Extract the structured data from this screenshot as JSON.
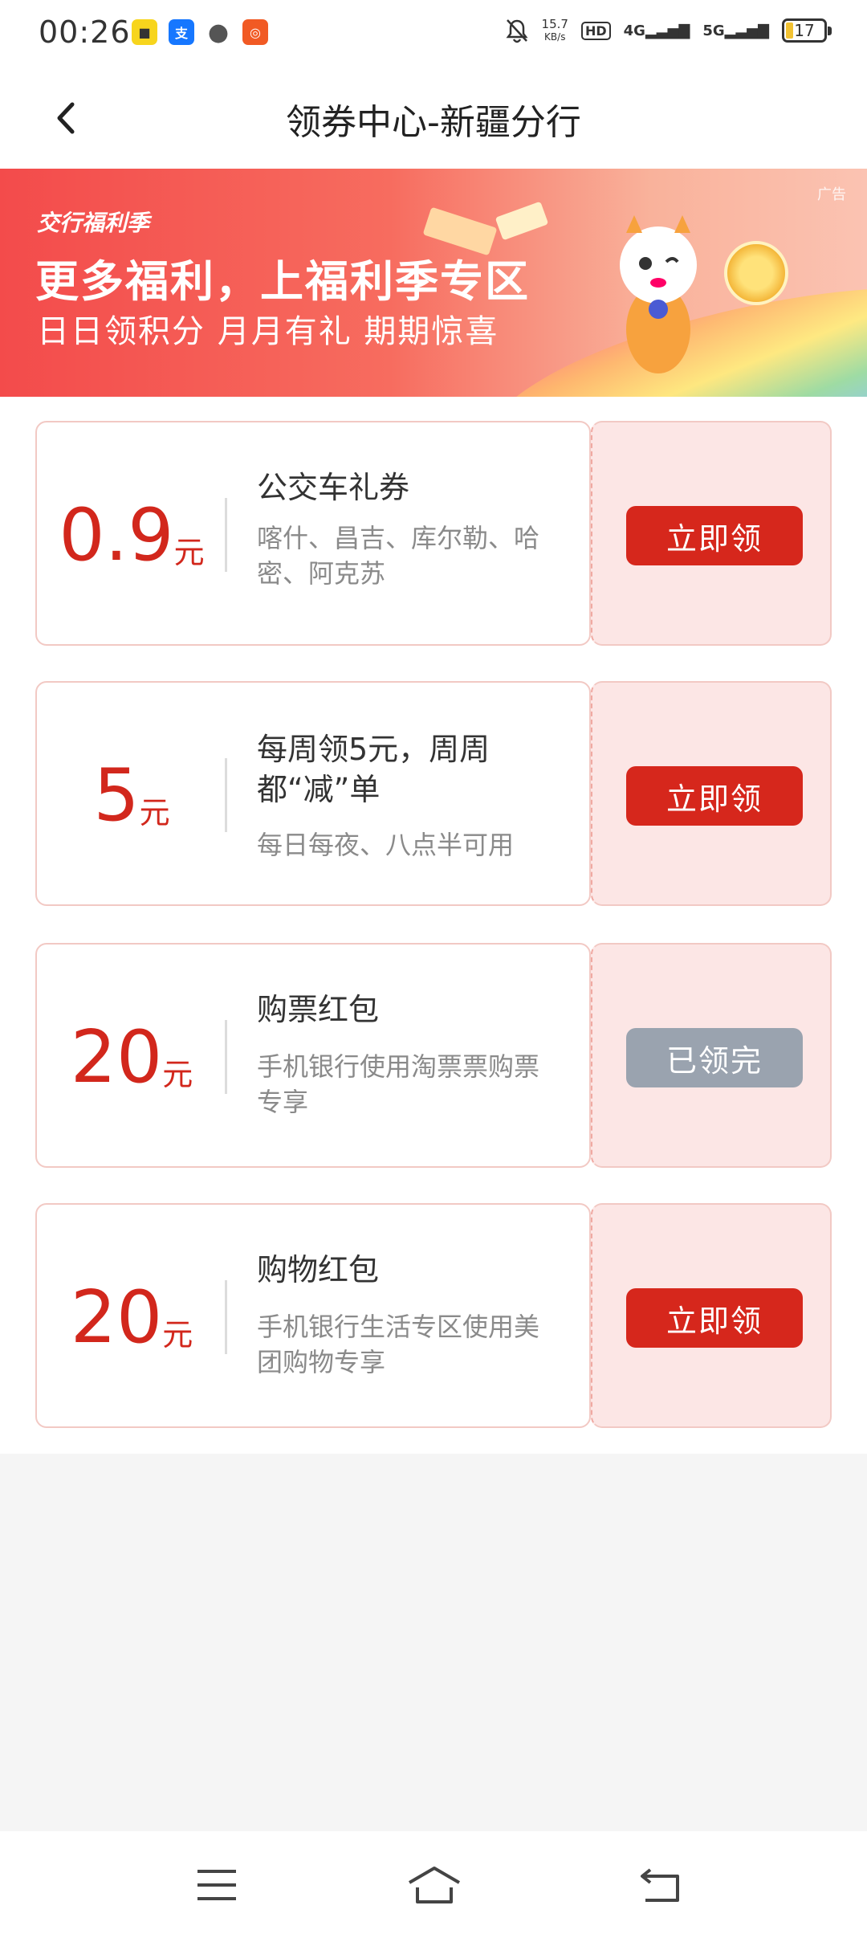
{
  "status_bar": {
    "time": "00:26",
    "net_speed_value": "15.7",
    "net_speed_unit": "KB/s",
    "hd_label": "HD",
    "signal_4g": "4G",
    "signal_5g": "5G",
    "battery": "17",
    "app_icons": [
      "app-icon-yellow",
      "alipay-icon",
      "chat-icon",
      "orange-app-icon"
    ]
  },
  "header": {
    "title": "领券中心-新疆分行"
  },
  "banner": {
    "brand": "交行福利季",
    "title": "更多福利，上福利季专区",
    "subtitle": "日日领积分 月月有礼 期期惊喜",
    "ad_label": "广告"
  },
  "coupons": [
    {
      "amount": "0.9",
      "unit": "元",
      "title": "公交车礼券",
      "desc": "喀什、昌吉、库尔勒、哈密、阿克苏",
      "button": "立即领",
      "state": "active"
    },
    {
      "amount": "5",
      "unit": "元",
      "title": "每周领5元，周周都“减”单",
      "desc": "每日每夜、八点半可用",
      "button": "立即领",
      "state": "active"
    },
    {
      "amount": "20",
      "unit": "元",
      "title": "购票红包",
      "desc": "手机银行使用淘票票购票专享",
      "button": "已领完",
      "state": "disabled"
    },
    {
      "amount": "20",
      "unit": "元",
      "title": "购物红包",
      "desc": "手机银行生活专区使用美团购物专享",
      "button": "立即领",
      "state": "active"
    }
  ],
  "colors": {
    "accent_red": "#d6271c",
    "coupon_right_bg": "#fce6e5",
    "disabled_button": "#9aa3af"
  }
}
